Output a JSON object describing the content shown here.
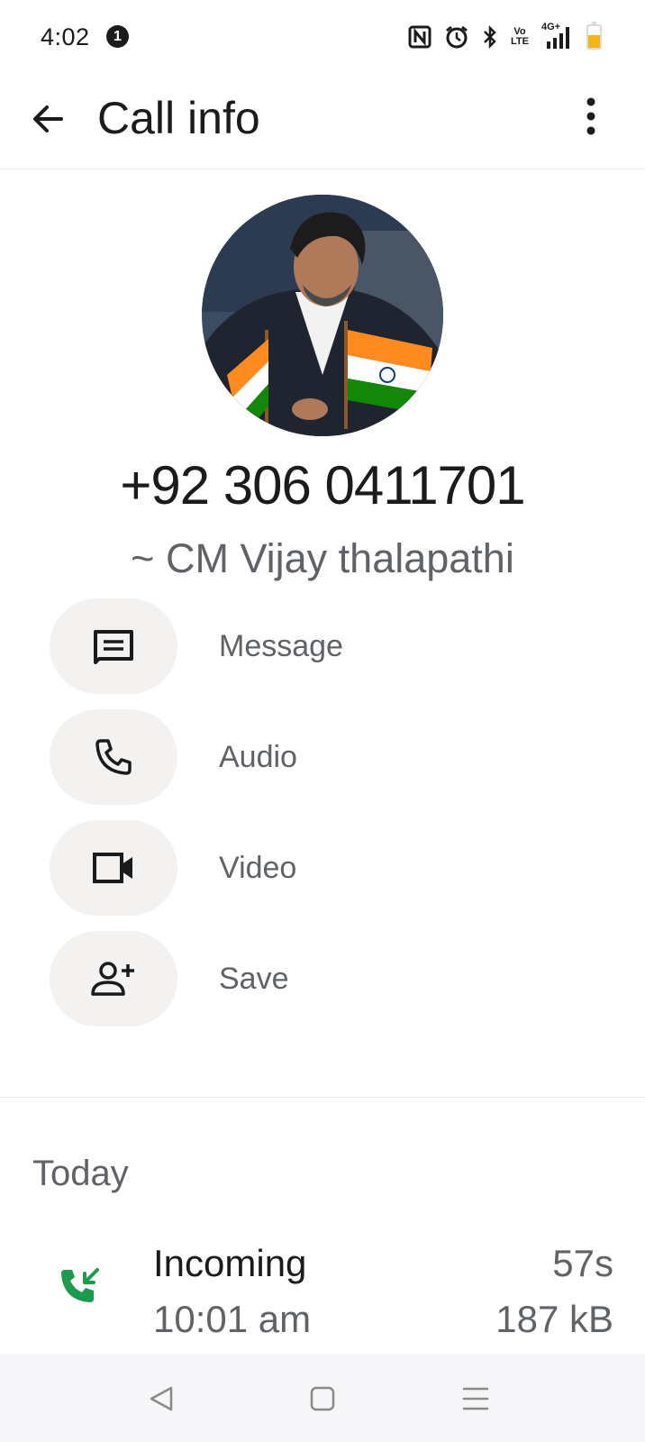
{
  "status_bar": {
    "time": "4:02",
    "notification_count": "1",
    "volte_line1": "Vo",
    "volte_line2": "LTE",
    "network": "4G+",
    "icons": [
      "nfc-icon",
      "alarm-icon",
      "bluetooth-icon",
      "volte-icon",
      "signal-icon",
      "battery-icon"
    ],
    "battery_level": 0.6,
    "battery_color": "#f5b515"
  },
  "app_bar": {
    "title": "Call info",
    "back_icon": "arrow-back-icon",
    "menu_icon": "more-vert-icon"
  },
  "contact": {
    "phone_number": "+92 306 0411701",
    "profile_name": "~ CM Vijay thalapathi"
  },
  "actions": [
    {
      "label": "Message",
      "icon": "message-icon"
    },
    {
      "label": "Audio",
      "icon": "phone-icon"
    },
    {
      "label": "Video",
      "icon": "video-camera-icon"
    },
    {
      "label": "Save",
      "icon": "person-add-icon"
    }
  ],
  "history": {
    "section_title": "Today",
    "entries": [
      {
        "type": "Incoming",
        "time": "10:01 am",
        "duration": "57s",
        "data_used": "187 kB",
        "icon": "incoming-call-icon",
        "icon_color": "#1e9a4f"
      }
    ]
  },
  "nav_bar": {
    "buttons": [
      "back-triangle-icon",
      "home-square-icon",
      "recents-menu-icon"
    ]
  },
  "colors": {
    "primary_text": "#1b1b1b",
    "secondary_text": "#5f6368",
    "action_bg": "#f3f2f0",
    "incoming_green": "#1e9a4f"
  }
}
